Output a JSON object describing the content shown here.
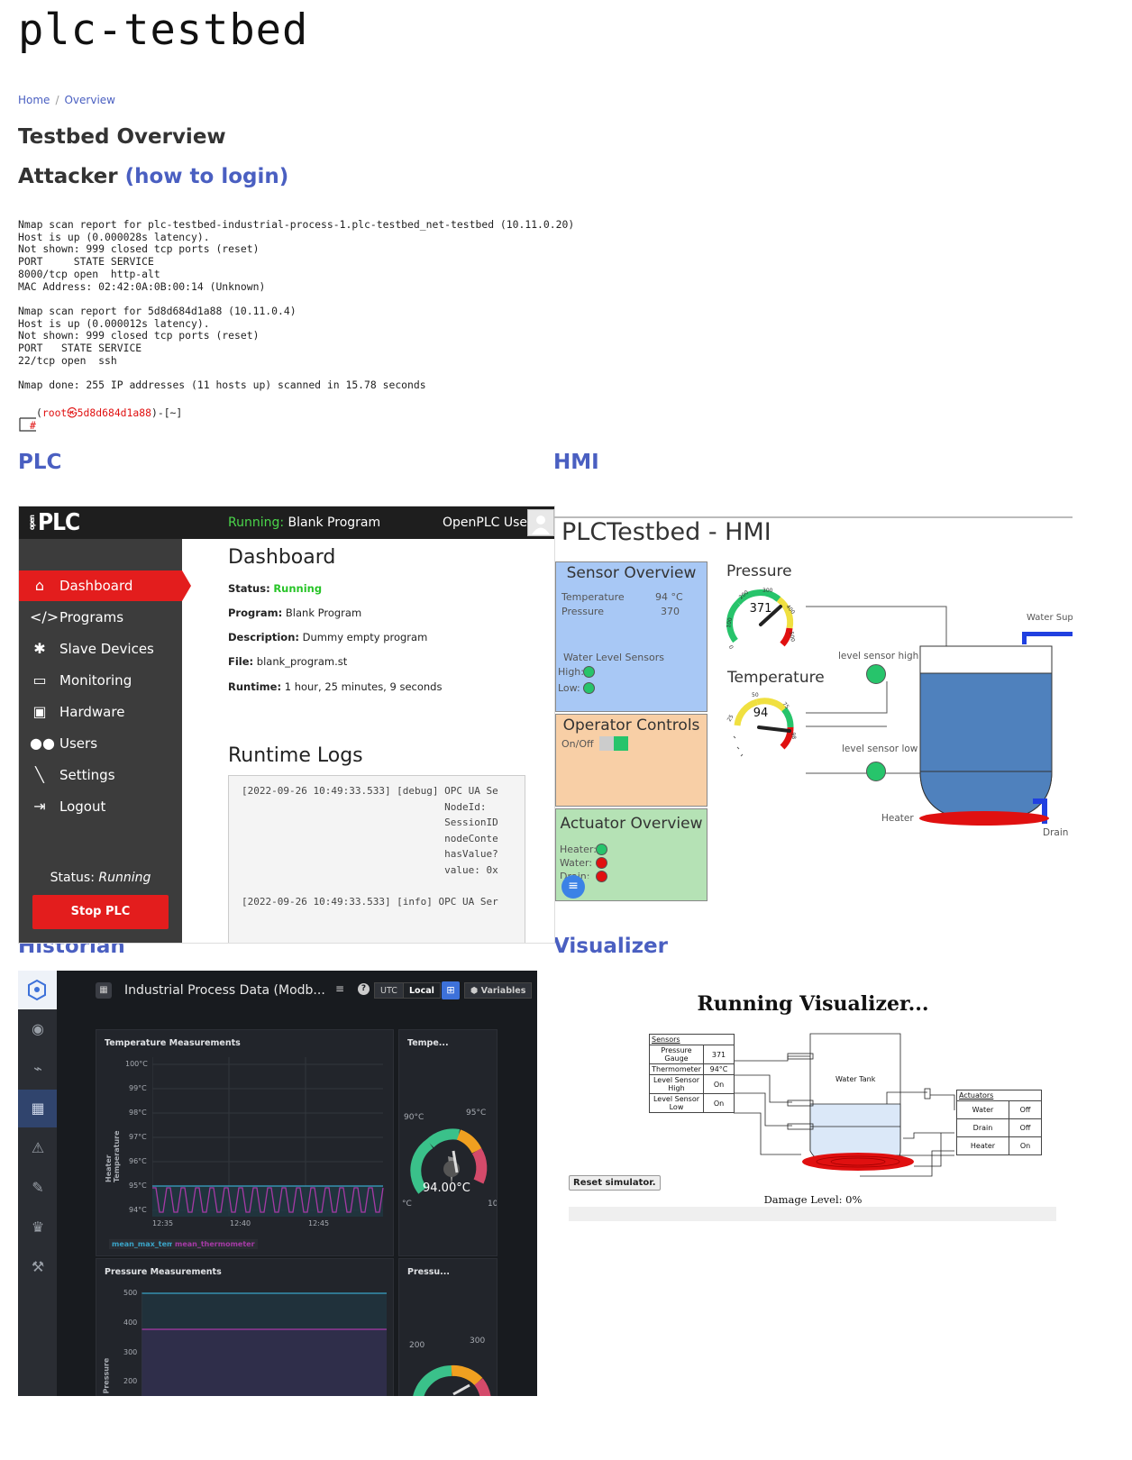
{
  "site": {
    "title": "plc-testbed"
  },
  "breadcrumb": {
    "home": "Home",
    "current": "Overview"
  },
  "page": {
    "heading": "Testbed Overview"
  },
  "attacker": {
    "heading": "Attacker",
    "login_link": "(how to login)",
    "terminal_output": "Nmap scan report for plc-testbed-industrial-process-1.plc-testbed_net-testbed (10.11.0.20)\nHost is up (0.000028s latency).\nNot shown: 999 closed tcp ports (reset)\nPORT     STATE SERVICE\n8000/tcp open  http-alt\nMAC Address: 02:42:0A:0B:00:14 (Unknown)\n\nNmap scan report for 5d8d684d1a88 (10.11.0.4)\nHost is up (0.000012s latency).\nNot shown: 999 closed tcp ports (reset)\nPORT   STATE SERVICE\n22/tcp open  ssh\n\nNmap done: 255 IP addresses (11 hosts up) scanned in 15.78 seconds",
    "prompt_open": "(",
    "prompt_user": "root㉿5d8d684d1a88",
    "prompt_close": ")-[~]",
    "prompt_hash": "#"
  },
  "sections": {
    "plc": "PLC",
    "hmi": "HMI",
    "historian": "Historian",
    "visualizer": "Visualizer"
  },
  "plc": {
    "logo": "PLC",
    "logo_small": "open",
    "running_label": "Running:",
    "program_name": "Blank Program",
    "user": "OpenPLC User",
    "menu": [
      {
        "label": "Dashboard",
        "icon": "home-icon"
      },
      {
        "label": "Programs",
        "icon": "code-icon"
      },
      {
        "label": "Slave Devices",
        "icon": "cog-cluster-icon"
      },
      {
        "label": "Monitoring",
        "icon": "monitor-icon"
      },
      {
        "label": "Hardware",
        "icon": "chip-icon"
      },
      {
        "label": "Users",
        "icon": "users-icon"
      },
      {
        "label": "Settings",
        "icon": "wrench-icon"
      },
      {
        "label": "Logout",
        "icon": "logout-icon"
      }
    ],
    "status_label": "Status:",
    "status_value": "Running",
    "stop_button": "Stop PLC",
    "dashboard_title": "Dashboard",
    "fields": {
      "status_key": "Status:",
      "status_val": "Running",
      "program_key": "Program:",
      "program_val": "Blank Program",
      "description_key": "Description:",
      "description_val": "Dummy empty program",
      "file_key": "File:",
      "file_val": "blank_program.st",
      "runtime_key": "Runtime:",
      "runtime_val": "1 hour, 25 minutes, 9 seconds"
    },
    "logs_title": "Runtime Logs",
    "logs": "[2022-09-26 10:49:33.533] [debug] OPC UA Se\n                                  NodeId:\n                                  SessionID\n                                  nodeConte\n                                  hasValue?\n                                  value: 0x\n\n[2022-09-26 10:49:33.533] [info] OPC UA Ser"
  },
  "hmi": {
    "title": "PLCTestbed - HMI",
    "sensor_overview": "Sensor Overview",
    "temperature_label": "Temperature",
    "temperature_value": "94 °C",
    "pressure_label": "Pressure",
    "pressure_value": "370",
    "water_level_sensors": "Water Level Sensors",
    "high_label": "High:",
    "low_label": "Low:",
    "operator_controls": "Operator Controls",
    "onoff_label": "On/Off",
    "actuator_overview": "Actuator Overview",
    "heater_label": "Heater:",
    "water_label": "Water:",
    "drain_label": "Drain:",
    "pressure_gauge_title": "Pressure",
    "pressure_gauge_value": "371",
    "pressure_ticks": [
      "100",
      "200",
      "300",
      "400",
      "500",
      "0"
    ],
    "temperature_gauge_title": "Temperature",
    "temperature_gauge_value": "94",
    "temperature_ticks": [
      "25",
      "50",
      "75",
      "98"
    ],
    "water_supply": "Water Supp",
    "level_sensor_high": "level sensor high",
    "level_sensor_low": "level sensor low",
    "heater": "Heater",
    "drain": "Drain",
    "colors": {
      "sensor_bg": "#a8c8f5",
      "controls_bg": "#f8cfa6",
      "actuator_bg": "#b5e2b5",
      "tank_water": "#4f81bd",
      "on": "#27c46b",
      "off": "#e01010"
    }
  },
  "historian": {
    "dashboard_title": "Industrial Process Data (Modb...",
    "utc": "UTC",
    "local": "Local",
    "variables": "Variables",
    "temp_panel_title": "Temperature Measurements",
    "temp_small_title": "Tempe...",
    "temp_y_label": "Heater Temperature",
    "temp_y_ticks": [
      "100°C",
      "99°C",
      "98°C",
      "97°C",
      "96°C",
      "95°C",
      "94°C"
    ],
    "temp_x_ticks": [
      "12:35",
      "12:40",
      "12:45"
    ],
    "legend_1": "mean_max_temp",
    "legend_2": "mean_thermometer",
    "gauge_low": "90°C",
    "gauge_high": "95°C",
    "gauge_value": "94.00°C",
    "gauge_edge_left": "°C",
    "gauge_edge_right": "10",
    "press_panel_title": "Pressure Measurements",
    "press_small_title": "Pressu...",
    "press_y_label": "Pressure",
    "press_y_ticks": [
      "500",
      "400",
      "300",
      "200"
    ],
    "press_gauge_low": "200",
    "press_gauge_high": "300"
  },
  "visualizer": {
    "title": "Running Visualizer...",
    "sensors_header": "Sensors",
    "sensors": [
      {
        "name": "Pressure Gauge",
        "value": "371"
      },
      {
        "name": "Thermometer",
        "value": "94°C"
      },
      {
        "name": "Level Sensor High",
        "value": "On"
      },
      {
        "name": "Level Sensor Low",
        "value": "On"
      }
    ],
    "tank_label": "Water Tank",
    "actuators_header": "Actuators",
    "actuators": [
      {
        "name": "Water",
        "value": "Off"
      },
      {
        "name": "Drain",
        "value": "Off"
      },
      {
        "name": "Heater",
        "value": "On"
      }
    ],
    "reset_button": "Reset simulator.",
    "damage_label": "Damage Level: 0%",
    "damage_level": 0
  }
}
